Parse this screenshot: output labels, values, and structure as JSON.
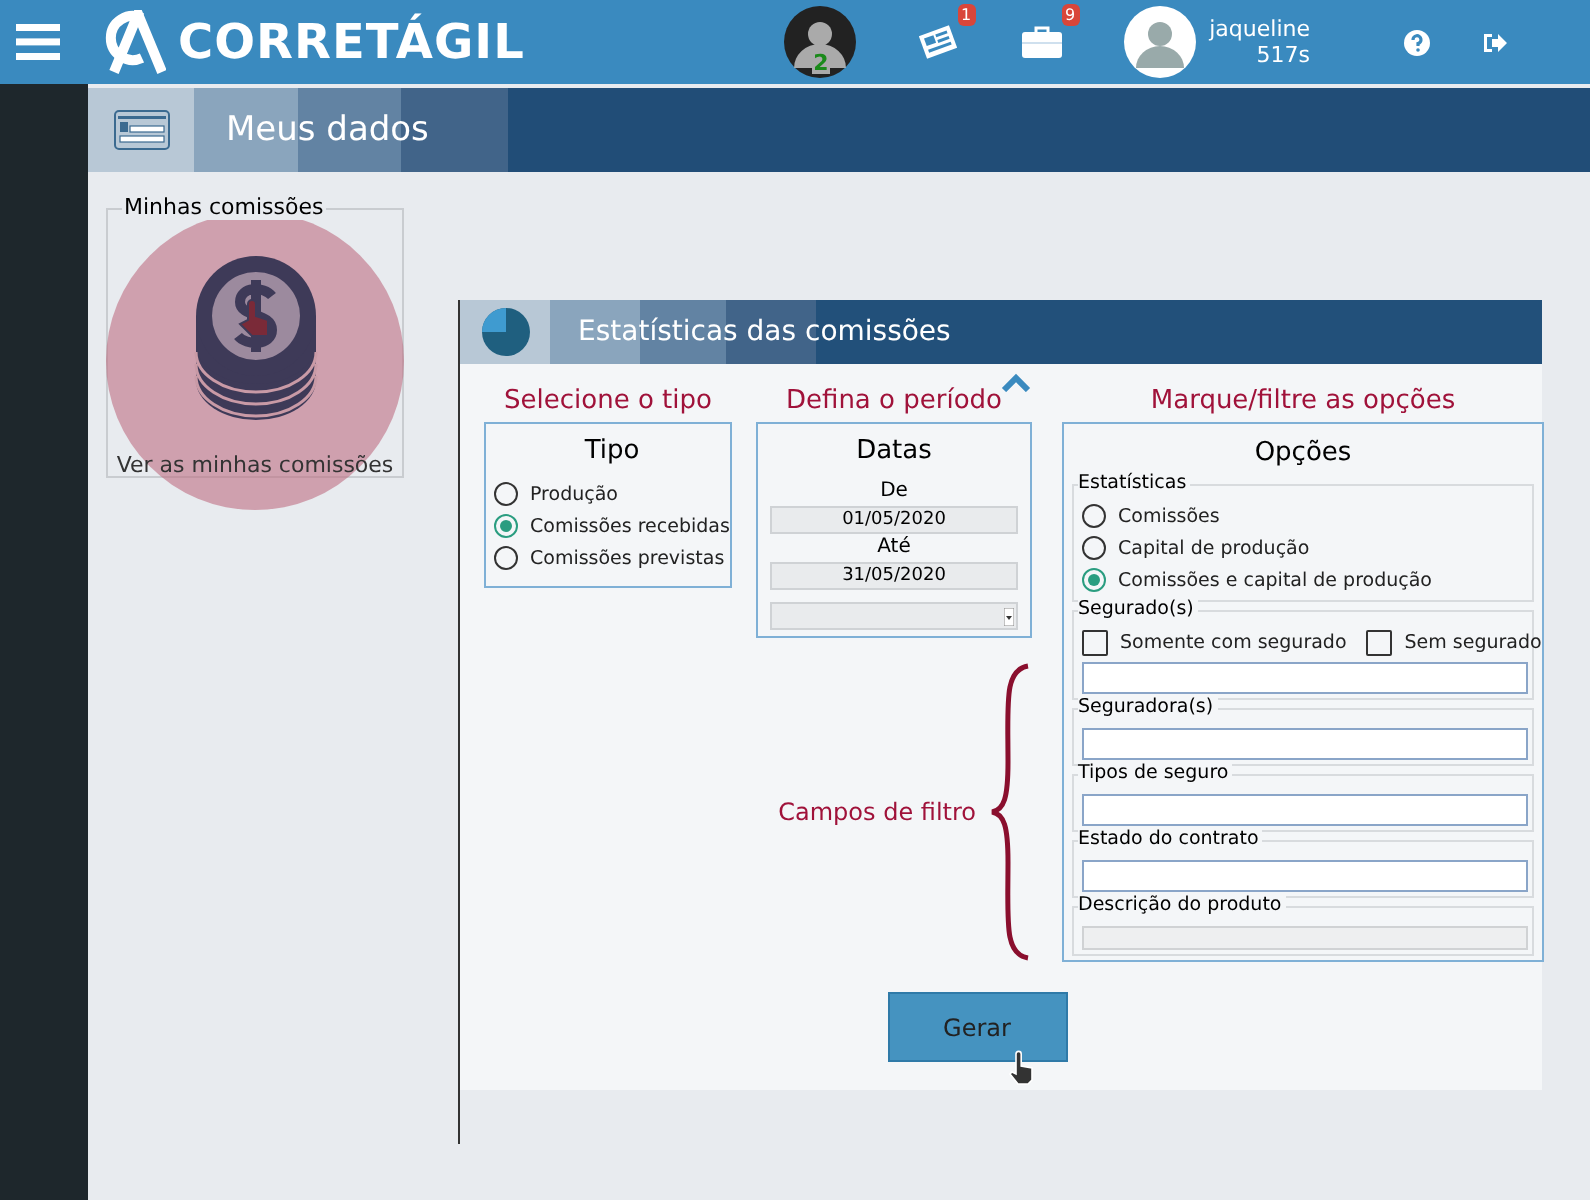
{
  "topbar": {
    "logo_text": "CORRETÁGIL",
    "team_count": "2",
    "news_badge": "1",
    "briefcase_badge": "9",
    "user": {
      "name": "jaqueline",
      "time": "517s"
    }
  },
  "page_header": {
    "title": "Meus dados"
  },
  "card": {
    "legend": "Minhas comissões",
    "link": "Ver as minhas comissões"
  },
  "stats_panel": {
    "title": "Estatísticas das comissões",
    "tipo": {
      "caption": "Selecione o tipo",
      "title": "Tipo",
      "options": [
        {
          "label": "Produção",
          "selected": false
        },
        {
          "label": "Comissões recebidas",
          "selected": true
        },
        {
          "label": "Comissões previstas",
          "selected": false
        }
      ]
    },
    "datas": {
      "caption": "Defina o período",
      "title": "Datas",
      "from_label": "De",
      "from_value": "01/05/2020",
      "to_label": "Até",
      "to_value": "31/05/2020"
    },
    "opcoes": {
      "caption": "Marque/filtre as opções",
      "title": "Opções",
      "estatisticas": {
        "legend": "Estatísticas",
        "options": [
          {
            "label": "Comissões",
            "selected": false
          },
          {
            "label": "Capital de produção",
            "selected": false
          },
          {
            "label": "Comissões e capital de produção",
            "selected": true
          }
        ]
      },
      "filters": [
        {
          "legend": "Segurado(s)",
          "disabled": false,
          "checkboxes": [
            {
              "label": "Somente com segurado",
              "checked": false
            },
            {
              "label": "Sem segurado",
              "checked": false
            }
          ]
        },
        {
          "legend": "Seguradora(s)",
          "disabled": false
        },
        {
          "legend": "Tipos de seguro",
          "disabled": false
        },
        {
          "legend": "Estado do contrato",
          "disabled": false
        },
        {
          "legend": "Descrição do produto",
          "disabled": true
        }
      ]
    },
    "annotation": "Campos de filtro",
    "button": "Gerar"
  }
}
